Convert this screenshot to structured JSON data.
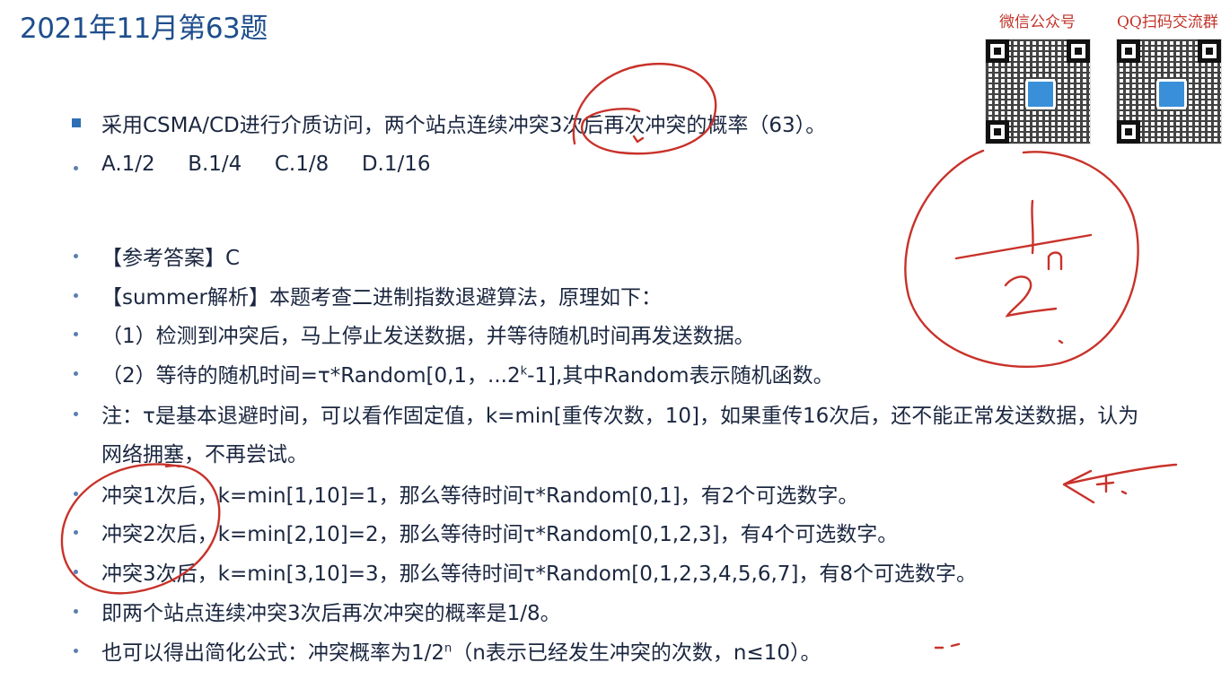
{
  "title": "2021年11月第63题",
  "qr_codes": [
    {
      "label": "微信公众号"
    },
    {
      "label": "QQ扫码交流群"
    }
  ],
  "question": "采用CSMA/CD进行介质访问，两个站点连续冲突3次后再次冲突的概率（63）。",
  "options": "A.1/2     B.1/4     C.1/8     D.1/16",
  "lines": {
    "answer": "【参考答案】C",
    "analysis": "【summer解析】本题考查二进制指数退避算法，原理如下：",
    "step1": "（1）检测到冲突后，马上停止发送数据，并等待随机时间再发送数据。",
    "step2_pre": "（2）等待的随机时间=τ*Random[0,1，...2",
    "step2_sup": "k",
    "step2_post": "-1],其中Random表示随机函数。",
    "note_1": "注：τ是基本退避时间，可以看作固定值，k=min[重传次数，10]，如果重传16次后，还不能正常发送数据，认为",
    "note_2": "网络拥塞，不再尝试。",
    "c1": "冲突1次后，k=min[1,10]=1，那么等待时间τ*Random[0,1]，有2个可选数字。",
    "c2": "冲突2次后，k=min[2,10]=2，那么等待时间τ*Random[0,1,2,3]，有4个可选数字。",
    "c3": "冲突3次后，k=min[3,10]=3，那么等待时间τ*Random[0,1,2,3,4,5,6,7]，有8个可选数字。",
    "conclusion": "即两个站点连续冲突3次后再次冲突的概率是1/8。",
    "formula_pre": "也可以得出简化公式：冲突概率为1/2",
    "formula_sup": "n",
    "formula_post": "（n表示已经发生冲突的次数，n≤10）。"
  },
  "colors": {
    "title": "#1e4e8c",
    "ink": "#c8322a",
    "label": "#c2332a",
    "bullet": "#2f6fb3"
  }
}
